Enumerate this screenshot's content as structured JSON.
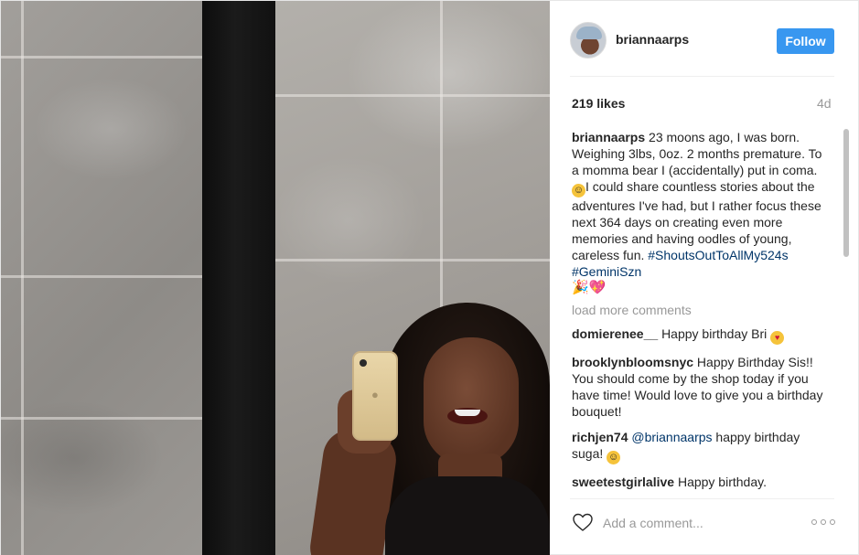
{
  "header": {
    "username": "briannaarps",
    "follow_label": "Follow"
  },
  "stats": {
    "likes": "219 likes",
    "time": "4d"
  },
  "caption": {
    "username": "briannaarps",
    "text_a": "23 moons ago, I was born. Weighing 3lbs, 0oz. 2 months premature. To a momma bear I (accidentally) put in coma. ",
    "text_b": "I could share countless stories about the adventures I've had, but I rather focus these next 364 days on creating even more memories and having oodles of young, careless fun.",
    "hashtag_1": "#ShoutsOutToAllMy524s",
    "hashtag_2": "#GeminiSzn",
    "party_emoji": "🎉💖"
  },
  "load_more": "load more comments",
  "comments": [
    {
      "username": "domierenee__",
      "text": "Happy birthday Bri "
    },
    {
      "username": "brooklynbloomsnyc",
      "text": "Happy Birthday Sis!! You should come by the shop today if you have time! Would love to give you a birthday bouquet!"
    },
    {
      "username": "richjen74",
      "mention": "@briannaarps",
      "text": " happy birthday suga! "
    },
    {
      "username": "sweetestgirlalive",
      "text": "Happy birthday."
    }
  ],
  "footer": {
    "comment_placeholder": "Add a comment...",
    "more_label": "ooo"
  },
  "icons": {
    "like": "heart-outline-icon",
    "more": "more-options-icon",
    "emoji_sweat": "grinning-sweat-emoji",
    "emoji_heart_eyes": "heart-eyes-emoji",
    "emoji_wink": "winking-emoji"
  },
  "colors": {
    "accent": "#3897f0",
    "hashtag": "#003569",
    "muted": "#999999"
  }
}
